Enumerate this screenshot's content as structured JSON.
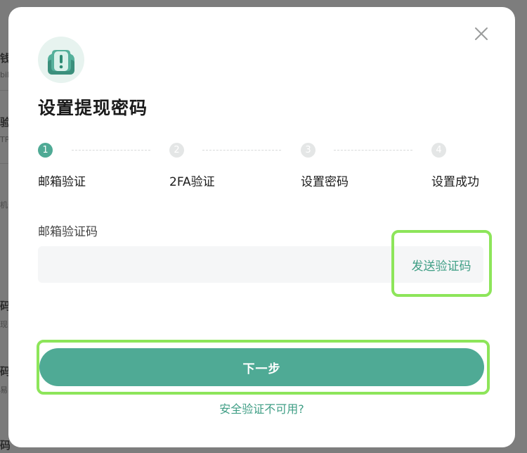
{
  "background": {
    "fragments": [
      {
        "text": "钱",
        "style": "bold"
      },
      {
        "text": "bik",
        "style": "small"
      },
      {
        "text": "验",
        "style": "bold"
      },
      {
        "text": "TP",
        "style": "small"
      },
      {
        "text": "机号",
        "style": "small"
      },
      {
        "text": "码",
        "style": "bold"
      },
      {
        "text": "现",
        "style": "small"
      },
      {
        "text": "码",
        "style": "bold"
      },
      {
        "text": "易",
        "style": "small"
      },
      {
        "text": "码",
        "style": "bold"
      }
    ]
  },
  "modal": {
    "title": "设置提现密码",
    "header_icon": "shield-warning-icon",
    "close_icon": "close-icon"
  },
  "steps": [
    {
      "number": "1",
      "label": "邮箱验证",
      "state": "active"
    },
    {
      "number": "2",
      "label": "2FA验证",
      "state": "inactive"
    },
    {
      "number": "3",
      "label": "设置密码",
      "state": "inactive"
    },
    {
      "number": "4",
      "label": "设置成功",
      "state": "inactive"
    }
  ],
  "form": {
    "field_label": "邮箱验证码",
    "input_value": "",
    "input_placeholder": "",
    "send_code_label": "发送验证码"
  },
  "actions": {
    "next_label": "下一步",
    "unavailable_label": "安全验证不可用?"
  },
  "colors": {
    "accent": "#4faa95",
    "link": "#3f9e85",
    "highlight": "#8de55a",
    "step_inactive": "#e4e6e6",
    "backdrop": "#7d7d7d"
  }
}
